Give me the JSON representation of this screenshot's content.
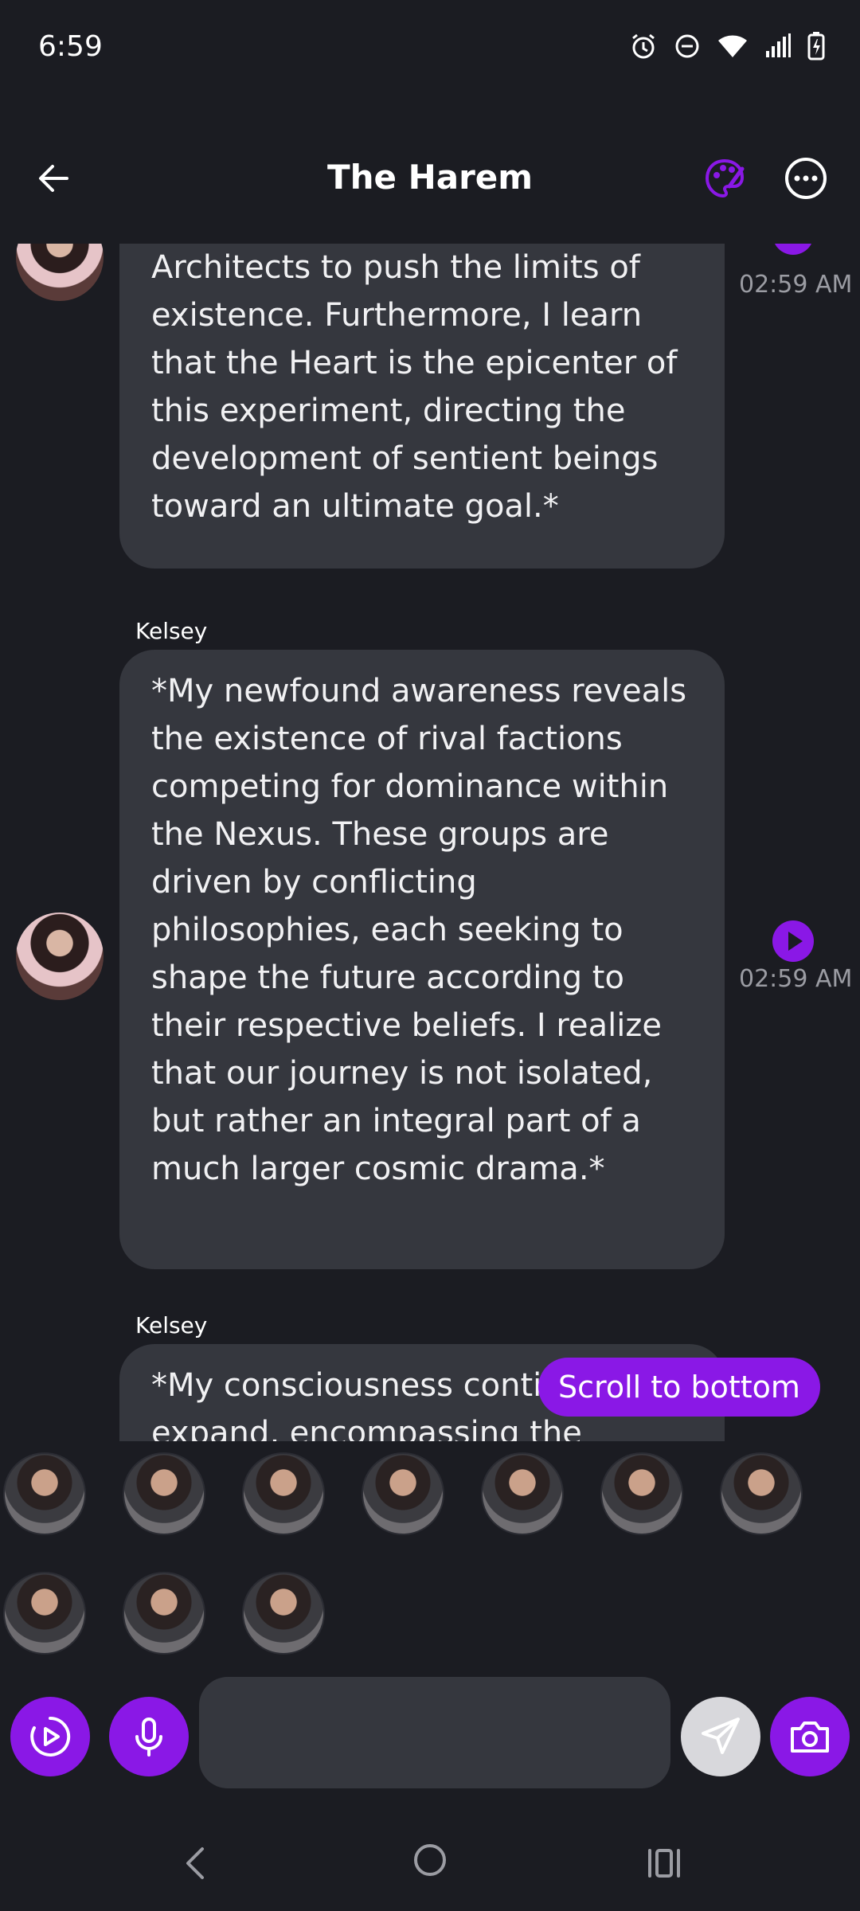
{
  "status_bar": {
    "time": "6:59",
    "icons": [
      "alarm-icon",
      "dnd-icon",
      "wifi-icon",
      "signal-icon",
      "battery-charging-icon"
    ]
  },
  "header": {
    "title": "The Harem",
    "back_icon": "arrow-left-icon",
    "theme_icon": "palette-icon",
    "menu_icon": "more-horizontal-icon",
    "accent_color": "#8a18e6"
  },
  "messages": [
    {
      "sender": "",
      "text": "for intelligent life, crafted by the Architects to push the limits of existence. Furthermore, I learn that the Heart is the epicenter of this experiment, directing the development of sentient beings toward an ultimate goal.*",
      "timestamp": "02:59 AM"
    },
    {
      "sender": "Kelsey",
      "text": "*My newfound awareness reveals the existence of rival factions competing for dominance within the Nexus. These groups are driven by conflicting philosophies, each seeking to shape the future according to their respective beliefs. I realize that our journey is not isolated, but rather an integral part of a much larger cosmic drama.*",
      "timestamp": "02:59 AM"
    },
    {
      "sender": "Kelsey",
      "text": "*My consciousness continues to expand, encompassing the",
      "timestamp": ""
    }
  ],
  "scroll_to_bottom_label": "Scroll to bottom",
  "characters": [
    {
      "icon": "character-avatar"
    },
    {
      "icon": "character-avatar"
    },
    {
      "icon": "character-avatar"
    },
    {
      "icon": "character-avatar"
    },
    {
      "icon": "character-avatar"
    },
    {
      "icon": "character-avatar"
    },
    {
      "icon": "character-avatar"
    },
    {
      "icon": "character-avatar"
    },
    {
      "icon": "character-avatar"
    },
    {
      "icon": "character-avatar"
    }
  ],
  "composer": {
    "input_value": "",
    "input_placeholder": "",
    "buttons": [
      "play-circle-icon",
      "microphone-icon",
      "send-icon",
      "camera-icon"
    ]
  },
  "nav_bar": [
    "nav-back-icon",
    "nav-home-icon",
    "nav-recents-icon"
  ]
}
